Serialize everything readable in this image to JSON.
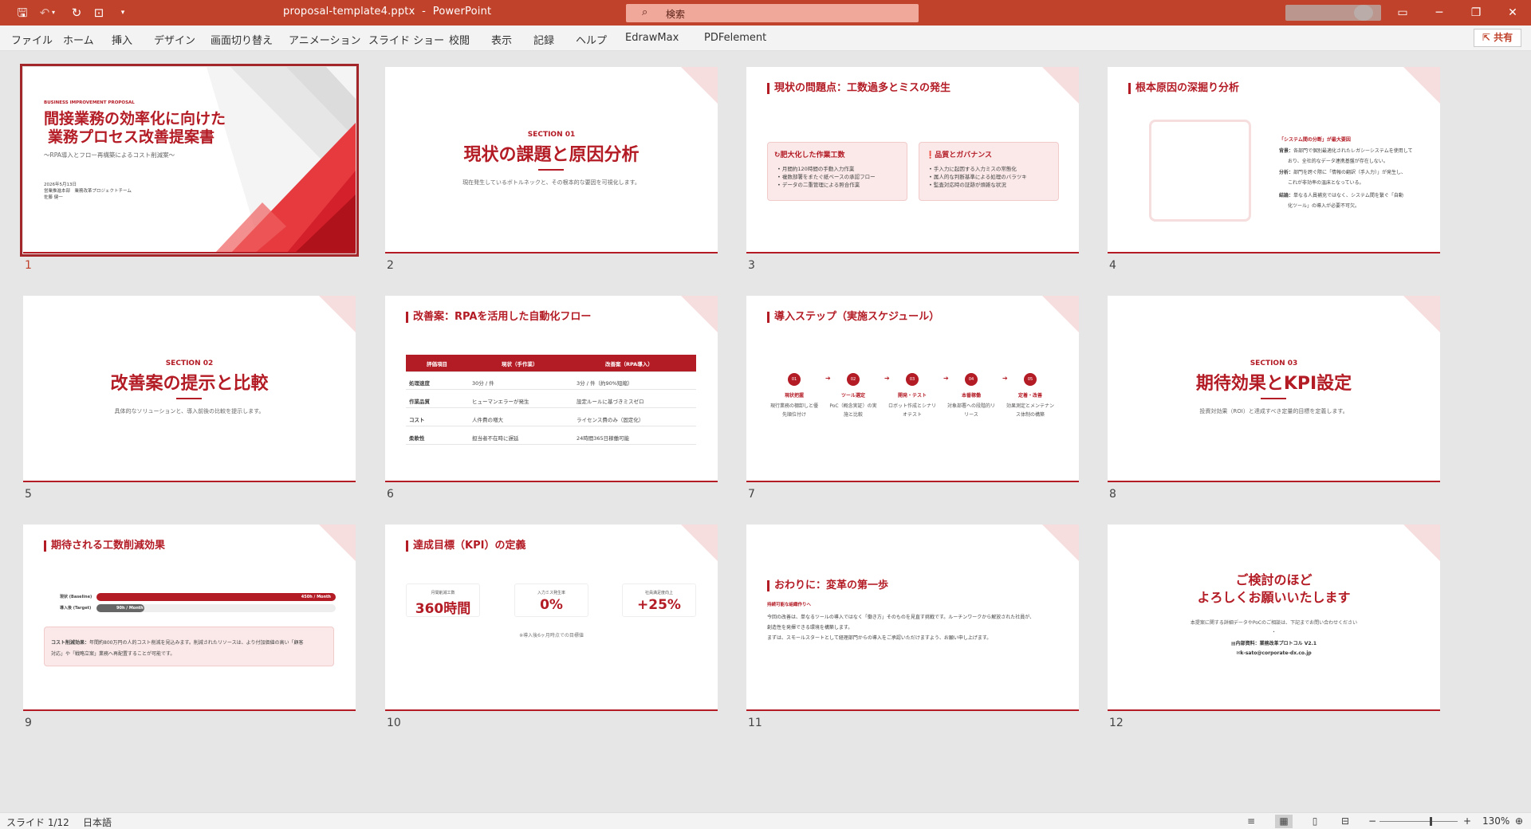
{
  "app": {
    "file_name": "proposal-template4.pptx",
    "separator": "-",
    "app_name": "PowerPoint",
    "search_placeholder": "検索"
  },
  "menu": [
    "ファイル",
    "ホーム",
    "挿入",
    "デザイン",
    "画面切り替え",
    "アニメーション",
    "スライド ショー",
    "校閲",
    "表示",
    "記録",
    "ヘルプ",
    "EdrawMax",
    "PDFelement"
  ],
  "share_label": "共有",
  "slides": {
    "s1": {
      "num": "1",
      "label": "BUSINESS IMPROVEMENT PROPOSAL",
      "title1": "間接業務の効率化に向けた",
      "title2": "業務プロセス改善提案書",
      "subtitle": "～RPA導入とフロー再構築によるコスト削減案～",
      "date": "2026年5月13日",
      "team": "営業推進本部　業務改革プロジェクトチーム",
      "author": "佐藤 健一"
    },
    "s2": {
      "num": "2",
      "section": "SECTION 01",
      "title": "現状の課題と原因分析",
      "sub": "現在発生しているボトルネックと、その根本的な要因を可視化します。"
    },
    "s3": {
      "num": "3",
      "heading": "現状の問題点：工数過多とミスの発生",
      "card1_title": "肥大化した作業工数",
      "card1_items": [
        "月間約120時間の手動入力作業",
        "複数部署をまたぐ紙ベースの承認フロー",
        "データの二重管理による照合作業"
      ],
      "card2_title": "品質とガバナンス",
      "card2_items": [
        "手入力に起因する入力ミスの常態化",
        "属人的な判断基準による処理のバラツキ",
        "監査対応時の証跡が煩雑な状況"
      ]
    },
    "s4": {
      "num": "4",
      "heading": "根本原因の深掘り分析",
      "callout": "「システム間の分断」が最大要因",
      "bg_label": "背景：",
      "bg_text1": "各部門で個別最適化されたレガシーシステムを使用して",
      "bg_text2": "おり、全社的なデータ連携基盤が存在しない。",
      "an_label": "分析：",
      "an_text1": "部門を跨ぐ際に「情報の翻訳（手入力）」が発生し、",
      "an_text2": "これが非効率の温床となっている。",
      "con_label": "結論：",
      "con_text1": "単なる人員補充ではなく、システム間を繋ぐ「自動",
      "con_text2": "化ツール」の導入が必要不可欠。"
    },
    "s5": {
      "num": "5",
      "section": "SECTION 02",
      "title": "改善案の提示と比較",
      "sub": "具体的なソリューションと、導入前後の比較を提示します。"
    },
    "s6": {
      "num": "6",
      "heading": "改善案：RPAを活用した自動化フロー",
      "headers": [
        "評価項目",
        "現状（手作業）",
        "改善案（RPA導入）"
      ],
      "rows": [
        [
          "処理速度",
          "30分 / 件",
          "3分 / 件（約90%短縮）"
        ],
        [
          "作業品質",
          "ヒューマンエラーが発生",
          "設定ルールに基づきミスゼロ"
        ],
        [
          "コスト",
          "人件費の増大",
          "ライセンス費のみ（固定化）"
        ],
        [
          "柔軟性",
          "担当者不在時に遅延",
          "24時間365日稼働可能"
        ]
      ]
    },
    "s7": {
      "num": "7",
      "heading": "導入ステップ（実施スケジュール）",
      "steps": [
        {
          "n": "01",
          "label": "現状把握",
          "d1": "現行業務の棚卸しと優",
          "d2": "先順位付け"
        },
        {
          "n": "02",
          "label": "ツール選定",
          "d1": "PoC（概念実証）の実",
          "d2": "施と比較"
        },
        {
          "n": "03",
          "label": "開発・テスト",
          "d1": "ロボット作成とシナリ",
          "d2": "オテスト"
        },
        {
          "n": "04",
          "label": "本番稼働",
          "d1": "対象部署への段階的リ",
          "d2": "リース"
        },
        {
          "n": "05",
          "label": "定着・改善",
          "d1": "効果測定とメンテナン",
          "d2": "ス体制の構築"
        }
      ]
    },
    "s8": {
      "num": "8",
      "section": "SECTION 03",
      "title": "期待効果とKPI設定",
      "sub": "投資対効果（ROI）と達成すべき定量的目標を定義します。"
    },
    "s9": {
      "num": "9",
      "heading": "期待される工数削減効果",
      "bar1_label": "現状 (Baseline)",
      "bar1_value": "450h / Month",
      "bar1_fraction": 1.0,
      "bar2_label": "導入後 (Target)",
      "bar2_value": "90h / Month",
      "bar2_fraction": 0.2,
      "note_bold": "コスト削減効果：",
      "note1": "年間約800万円の人的コスト削減を見込みます。削減されたリソースは、より付加価値の高い「顧客",
      "note2": "対応」や「戦略立案」業務へ再配置することが可能です。"
    },
    "s10": {
      "num": "10",
      "heading": "達成目標（KPI）の定義",
      "kpis": [
        {
          "label": "月間削減工数",
          "value": "360時間"
        },
        {
          "label": "入力ミス発生率",
          "value": "0%"
        },
        {
          "label": "社員満足度向上",
          "value": "+25%"
        }
      ],
      "note": "※導入後6ヶ月時点での目標値"
    },
    "s11": {
      "num": "11",
      "heading": "おわりに：変革の第一歩",
      "sub": "持続可能な組織作りへ",
      "p1": "今回の改善は、単なるツールの導入ではなく「働き方」そのものを見直す挑戦です。ルーチンワークから解放された社員が、",
      "p2": "創造性を発揮できる環境を構築します。",
      "p3": "まずは、スモールスタートとして経理部門からの導入をご承認いただけますよう、お願い申し上げます。"
    },
    "s12": {
      "num": "12",
      "title1": "ご検討のほど",
      "title2": "よろしくお願いいたします",
      "sub": "本提案に関する詳細データやPoCのご相談は、下記までお問い合わせください",
      "dot": "・",
      "ref": "内部資料：業務改革プロトコル V2.1",
      "email": "k-sato@corporate-dx.co.jp"
    }
  },
  "status": {
    "slide_indicator": "スライド 1/12",
    "language": "日本語",
    "zoom": "130%"
  }
}
